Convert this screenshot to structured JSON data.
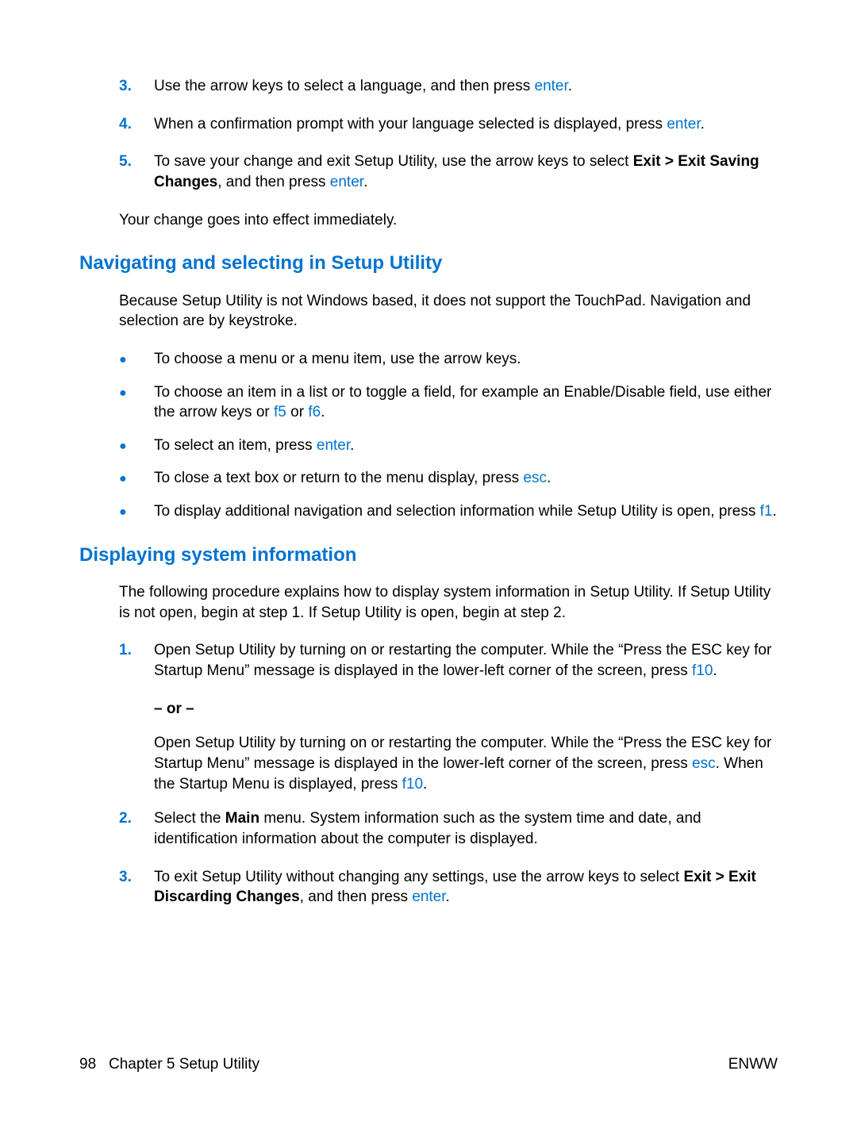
{
  "steps_top": {
    "s3": {
      "marker": "3.",
      "t1": "Use the arrow keys to select a language, and then press ",
      "k1": "enter",
      "t2": "."
    },
    "s4": {
      "marker": "4.",
      "t1": "When a confirmation prompt with your language selected is displayed, press ",
      "k1": "enter",
      "t2": "."
    },
    "s5": {
      "marker": "5.",
      "t1": "To save your change and exit Setup Utility, use the arrow keys to select ",
      "b1": "Exit > Exit Saving Changes",
      "t2": ", and then press ",
      "k1": "enter",
      "t3": "."
    }
  },
  "effect_line": "Your change goes into effect immediately.",
  "nav": {
    "heading": "Navigating and selecting in Setup Utility",
    "intro": "Because Setup Utility is not Windows based, it does not support the TouchPad. Navigation and selection are by keystroke.",
    "b1": "To choose a menu or a menu item, use the arrow keys.",
    "b2": {
      "t1": "To choose an item in a list or to toggle a field, for example an Enable/Disable field, use either the arrow keys or ",
      "k1": "f5",
      "t2": " or ",
      "k2": "f6",
      "t3": "."
    },
    "b3": {
      "t1": "To select an item, press ",
      "k1": "enter",
      "t2": "."
    },
    "b4": {
      "t1": "To close a text box or return to the menu display, press ",
      "k1": "esc",
      "t2": "."
    },
    "b5": {
      "t1": "To display additional navigation and selection information while Setup Utility is open, press ",
      "k1": "f1",
      "t2": "."
    }
  },
  "sys": {
    "heading": "Displaying system information",
    "intro": "The following procedure explains how to display system information in Setup Utility. If Setup Utility is not open, begin at step 1. If Setup Utility is open, begin at step 2.",
    "s1": {
      "marker": "1.",
      "t1": "Open Setup Utility by turning on or restarting the computer. While the “Press the ESC key for Startup Menu” message is displayed in the lower-left corner of the screen, press ",
      "k1": "f10",
      "t2": "."
    },
    "or": "– or –",
    "s1b": {
      "t1": "Open Setup Utility by turning on or restarting the computer. While the “Press the ESC key for Startup Menu” message is displayed in the lower-left corner of the screen, press ",
      "k1": "esc",
      "t2": ". When the Startup Menu is displayed, press ",
      "k2": "f10",
      "t3": "."
    },
    "s2": {
      "marker": "2.",
      "t1": "Select the ",
      "b1": "Main",
      "t2": " menu. System information such as the system time and date, and identification information about the computer is displayed."
    },
    "s3": {
      "marker": "3.",
      "t1": "To exit Setup Utility without changing any settings, use the arrow keys to select ",
      "b1": "Exit > Exit Discarding Changes",
      "t2": ", and then press ",
      "k1": "enter",
      "t3": "."
    }
  },
  "footer": {
    "page": "98",
    "chapter": "Chapter 5   Setup Utility",
    "right": "ENWW"
  }
}
